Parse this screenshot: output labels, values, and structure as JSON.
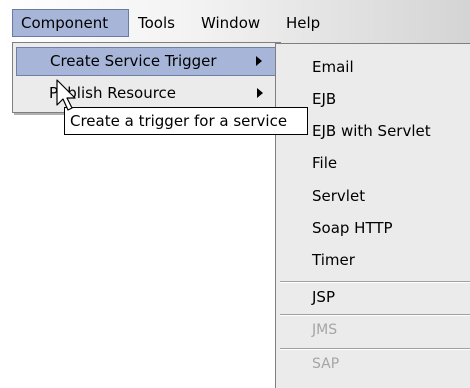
{
  "menubar": {
    "items": [
      {
        "label": "Component"
      },
      {
        "label": "Tools"
      },
      {
        "label": "Window"
      },
      {
        "label": "Help"
      }
    ]
  },
  "component_menu": {
    "items": [
      {
        "label": "Create Service Trigger"
      },
      {
        "label": "Publish Resource"
      }
    ]
  },
  "tooltip": {
    "text": "Create a trigger for a service"
  },
  "trigger_submenu": {
    "items": [
      {
        "label": "Email"
      },
      {
        "label": "EJB"
      },
      {
        "label": "EJB with Servlet"
      },
      {
        "label": "File"
      },
      {
        "label": "Servlet"
      },
      {
        "label": "Soap HTTP"
      },
      {
        "label": "Timer"
      },
      {
        "label": "JSP"
      },
      {
        "label": "JMS"
      },
      {
        "label": "SAP"
      }
    ]
  },
  "cursor_icon": "arrow-pointer-icon",
  "submenu_arrow_icon": "chevron-right-icon",
  "colors": {
    "highlight": "#a7b6d8",
    "menu_background": "#ebebeb",
    "disabled_text": "#a5a5a5"
  }
}
